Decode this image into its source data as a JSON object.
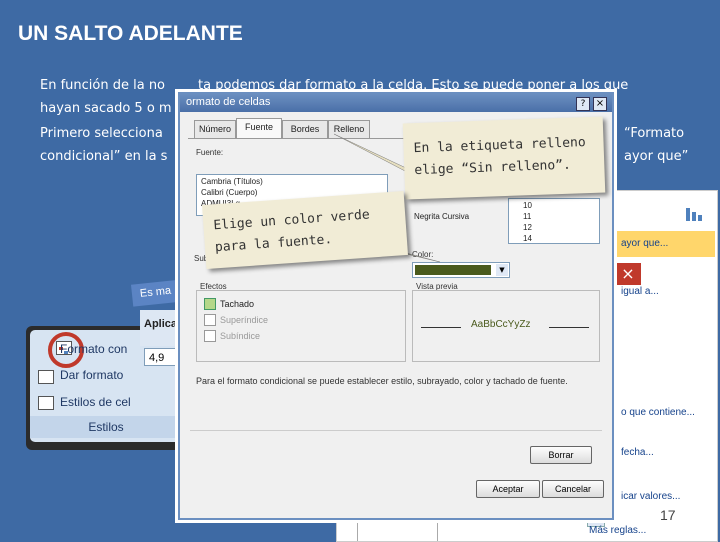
{
  "slide": {
    "title": "UN SALTO ADELANTE",
    "paragraph1_line1_a": "En función de la no",
    "paragraph1_line1_b": "ta podemos dar formato a la celda. Esto se puede poner a los que",
    "paragraph1_line2": "hayan sacado 5 o m",
    "paragraph2_line1_a": "Primero selecciona",
    "paragraph2_line1_b": "“Formato",
    "paragraph2_line2_a": "condicional” en la s",
    "paragraph2_line2_b": "ayor que”",
    "page_number": "17"
  },
  "right_menu": {
    "header_fragment": "ayor que...",
    "items": [
      "igual a...",
      "o que contiene...",
      "fecha...",
      "icar valores...",
      "Más reglas..."
    ]
  },
  "ribbon": {
    "items": [
      "Formato con",
      "Dar formato",
      "Estilos de cel"
    ],
    "group_label": "Estilos",
    "back_dialog_text_a": "Es ma",
    "back_dialog_text_b": "Aplica",
    "back_input_value": "4,9"
  },
  "dialog": {
    "title": "ormato de celdas",
    "tabs": [
      "Número",
      "Fuente",
      "Bordes",
      "Relleno"
    ],
    "font_label": "Fuente:",
    "fonts": [
      "Cambria (Títulos)",
      "Calibri (Cuerpo)",
      "ADMUI3Lg"
    ],
    "style_selected": "Negrita Cursiva",
    "sizes": [
      "10",
      "11",
      "12",
      "14"
    ],
    "underline_label": "Sub",
    "color_label": "Color:",
    "color_value": "#4a5a1c",
    "effects_label": "Efectos",
    "effects": [
      "Tachado",
      "Superíndice",
      "Subíndice"
    ],
    "preview_label": "Vista previa",
    "preview_text": "AaBbCcYyZz",
    "note": "Para el formato condicional se puede establecer estilo, subrayado, color y tachado de fuente.",
    "clear_button": "Borrar",
    "ok_button": "Aceptar",
    "cancel_button": "Cancelar",
    "help_icon": "?",
    "close_icon": "×"
  },
  "callouts": {
    "relleno_line1": "En la etiqueta relleno",
    "relleno_line2": "elige “Sin relleno”.",
    "verde_line1": "Elige un color verde",
    "verde_line2": "para la fuente."
  }
}
